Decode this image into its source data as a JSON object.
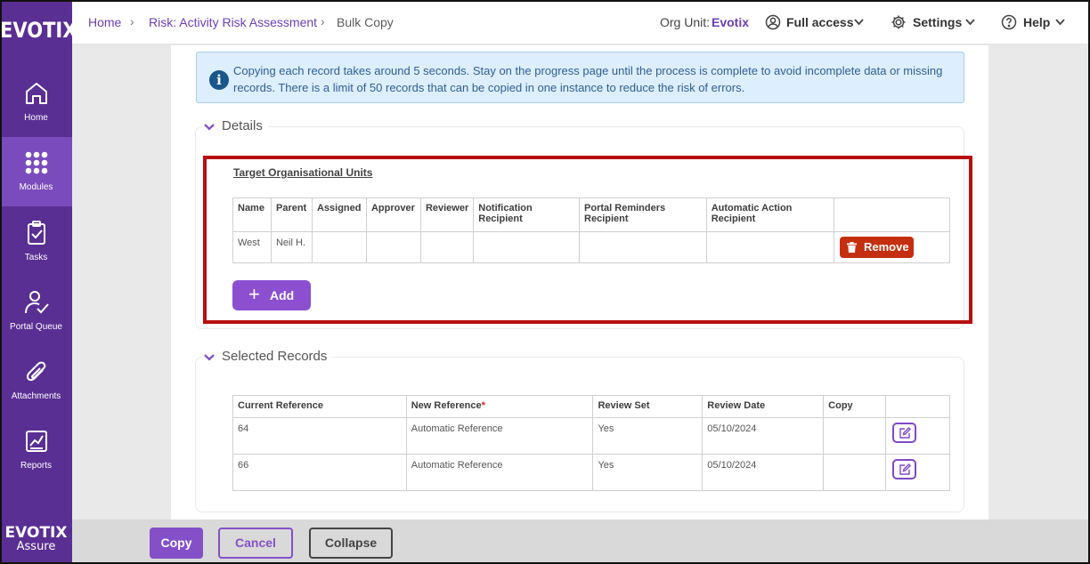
{
  "app": {
    "logo": "EVOTIX",
    "brand_name": "EVOTIX",
    "brand_sub": "Assure"
  },
  "sidebar": {
    "items": [
      {
        "label": "Home",
        "icon": "home-icon"
      },
      {
        "label": "Modules",
        "icon": "grid-dots-icon",
        "active": true
      },
      {
        "label": "Tasks",
        "icon": "clipboard-check-icon"
      },
      {
        "label": "Portal Queue",
        "icon": "user-check-icon"
      },
      {
        "label": "Attachments",
        "icon": "paperclip-icon"
      },
      {
        "label": "Reports",
        "icon": "chart-report-icon"
      }
    ]
  },
  "breadcrumb": {
    "home": "Home",
    "module": "Risk: Activity Risk Assessment",
    "current": "Bulk Copy"
  },
  "header": {
    "org_unit_label": "Org Unit:",
    "org_unit_value": "Evotix",
    "access": "Full access",
    "settings": "Settings",
    "help": "Help"
  },
  "info_banner": "Copying each record takes around 5 seconds. Stay on the progress page until the process is complete to avoid incomplete data or missing records. There is a limit of 50 records that can be copied in one instance to reduce the risk of errors.",
  "details": {
    "title": "Details",
    "target_label": "Target Organisational Units",
    "columns": [
      "Name",
      "Parent",
      "Assigned",
      "Approver",
      "Reviewer",
      "Notification Recipient",
      "Portal Reminders Recipient",
      "Automatic Action Recipient",
      ""
    ],
    "rows": [
      {
        "name": "West",
        "parent": "Neil H.",
        "assigned": "",
        "approver": "",
        "reviewer": "",
        "notification": "",
        "portal": "",
        "automatic": ""
      }
    ],
    "remove_label": "Remove",
    "add_label": "Add"
  },
  "selected_records": {
    "title": "Selected Records",
    "columns": [
      "Current Reference",
      "New Reference",
      "Review Set",
      "Review Date",
      "Copy",
      ""
    ],
    "required_mark": "*",
    "rows": [
      {
        "current": "64",
        "new": "Automatic Reference",
        "review_set": "Yes",
        "review_date": "05/10/2024",
        "copy": ""
      },
      {
        "current": "66",
        "new": "Automatic Reference",
        "review_set": "Yes",
        "review_date": "05/10/2024",
        "copy": ""
      }
    ]
  },
  "footer": {
    "copy": "Copy",
    "cancel": "Cancel",
    "collapse": "Collapse"
  },
  "colors": {
    "sidebar": "#5a2f93",
    "accent": "#8450c8",
    "danger": "#c42f10",
    "highlight_border": "#b80f10",
    "info_bg": "#ddeefe"
  }
}
